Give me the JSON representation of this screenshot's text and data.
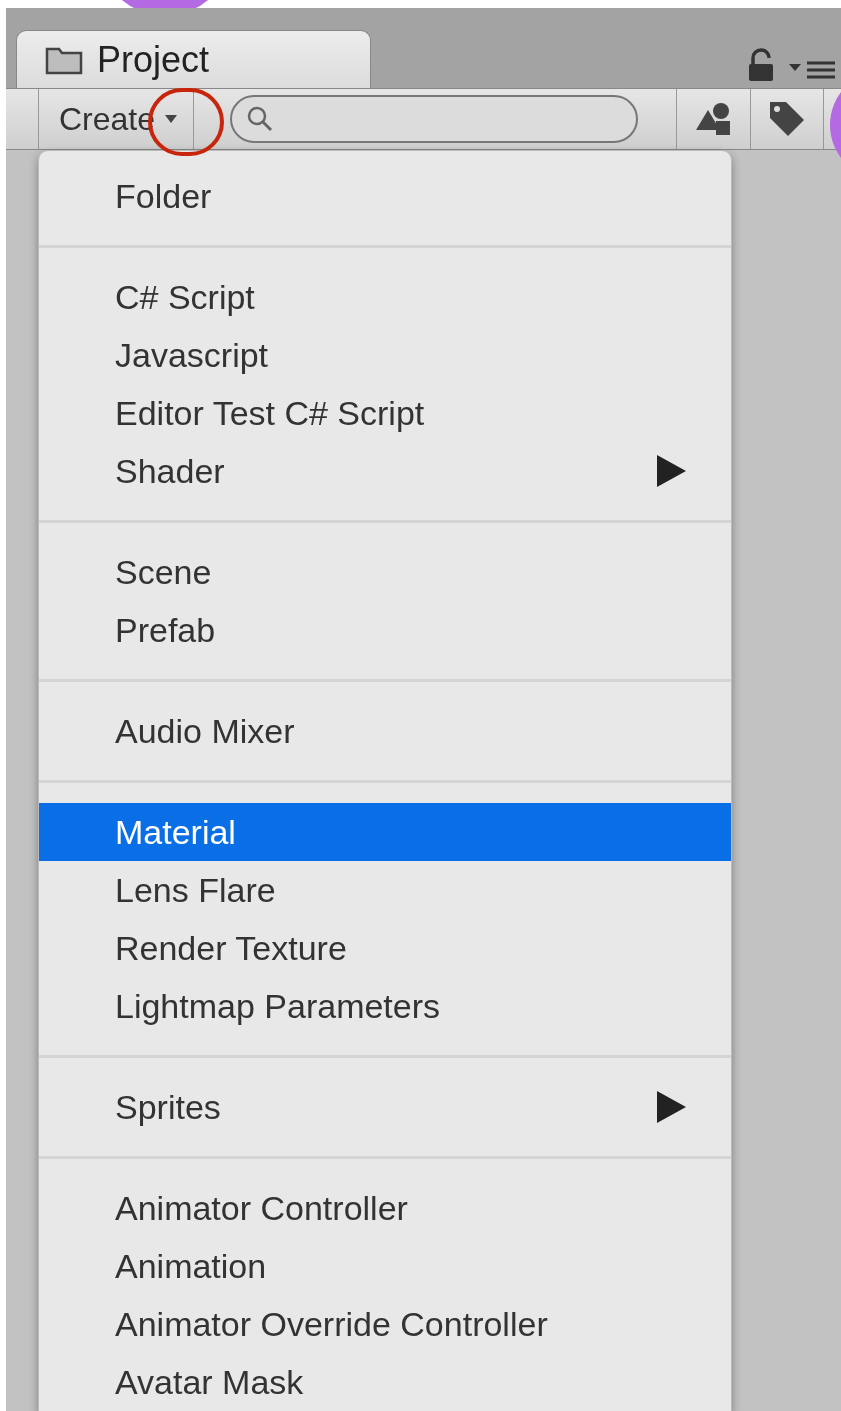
{
  "tab": {
    "label": "Project"
  },
  "toolbar": {
    "create_button": {
      "label": "Create"
    }
  },
  "menu": {
    "groups": [
      {
        "items": [
          {
            "label": "Folder",
            "selected": false,
            "submenu": false
          }
        ]
      },
      {
        "items": [
          {
            "label": "C# Script",
            "selected": false,
            "submenu": false
          },
          {
            "label": "Javascript",
            "selected": false,
            "submenu": false
          },
          {
            "label": "Editor Test C# Script",
            "selected": false,
            "submenu": false
          },
          {
            "label": "Shader",
            "selected": false,
            "submenu": true
          }
        ]
      },
      {
        "items": [
          {
            "label": "Scene",
            "selected": false,
            "submenu": false
          },
          {
            "label": "Prefab",
            "selected": false,
            "submenu": false
          }
        ]
      },
      {
        "items": [
          {
            "label": "Audio Mixer",
            "selected": false,
            "submenu": false
          }
        ]
      },
      {
        "items": [
          {
            "label": "Material",
            "selected": true,
            "submenu": false
          },
          {
            "label": "Lens Flare",
            "selected": false,
            "submenu": false
          },
          {
            "label": "Render Texture",
            "selected": false,
            "submenu": false
          },
          {
            "label": "Lightmap Parameters",
            "selected": false,
            "submenu": false
          }
        ]
      },
      {
        "items": [
          {
            "label": "Sprites",
            "selected": false,
            "submenu": true
          }
        ]
      },
      {
        "items": [
          {
            "label": "Animator Controller",
            "selected": false,
            "submenu": false
          },
          {
            "label": "Animation",
            "selected": false,
            "submenu": false
          },
          {
            "label": "Animator Override Controller",
            "selected": false,
            "submenu": false
          },
          {
            "label": "Avatar Mask",
            "selected": false,
            "submenu": false
          }
        ]
      }
    ]
  }
}
